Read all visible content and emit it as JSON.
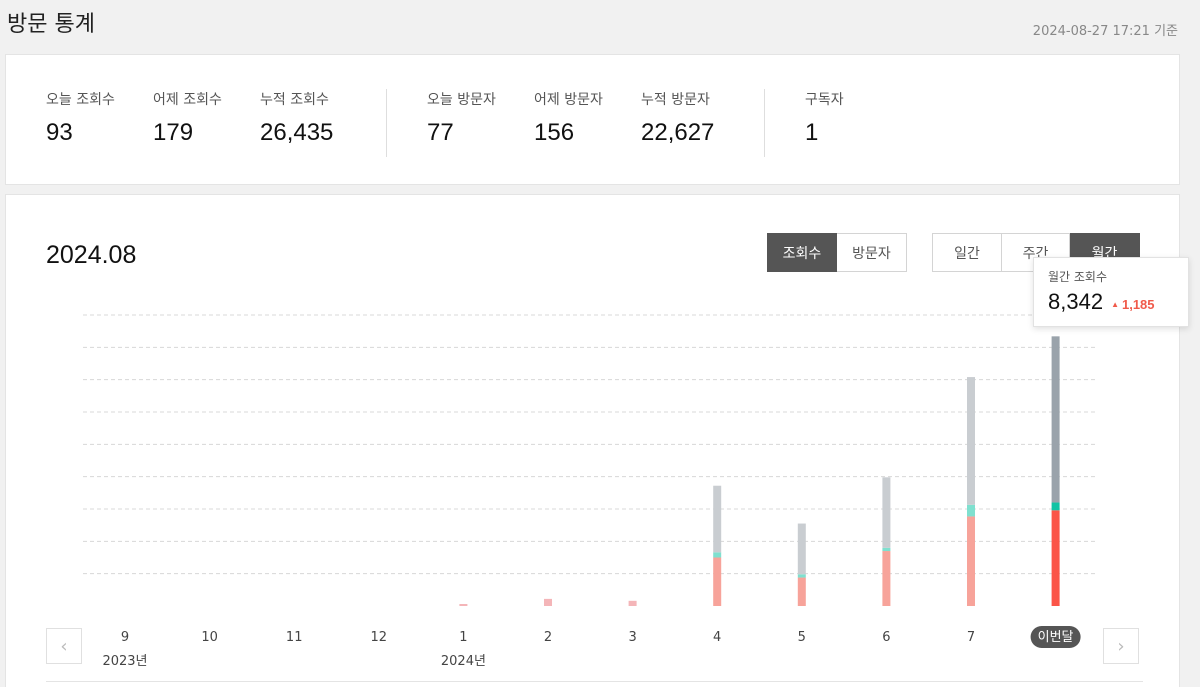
{
  "header": {
    "title": "방문 통계",
    "base_time": "2024-08-27 17:21 기준"
  },
  "stats": {
    "today_views": {
      "label": "오늘 조회수",
      "value": "93"
    },
    "yesterday_views": {
      "label": "어제 조회수",
      "value": "179"
    },
    "total_views": {
      "label": "누적 조회수",
      "value": "26,435"
    },
    "today_visitors": {
      "label": "오늘 방문자",
      "value": "77"
    },
    "yesterday_visitors": {
      "label": "어제 방문자",
      "value": "156"
    },
    "total_visitors": {
      "label": "누적 방문자",
      "value": "22,627"
    },
    "subscribers": {
      "label": "구독자",
      "value": "1"
    }
  },
  "chart_header": {
    "period": "2024.08",
    "metric_tabs": [
      "조회수",
      "방문자"
    ],
    "metric_active": 0,
    "range_tabs": [
      "일간",
      "주간",
      "월간"
    ],
    "range_active": 2
  },
  "tooltip": {
    "label": "월간 조회수",
    "value": "8,342",
    "change": "1,185"
  },
  "colors": {
    "gray": "#c9cdd1",
    "gray_active": "#9aa3ab",
    "teal": "#7fe0cf",
    "teal_active": "#12c3a4",
    "red": "#f7a39a",
    "red_active": "#fb5548",
    "tiny": "#f4b5b8"
  },
  "prev_arrow": "‹",
  "next_arrow": "›",
  "chart_data": {
    "type": "bar",
    "stacked": true,
    "categories": [
      "9",
      "10",
      "11",
      "12",
      "1",
      "2",
      "3",
      "4",
      "5",
      "6",
      "7",
      "이번달"
    ],
    "year_labels": [
      {
        "category": "9",
        "label": "2023년"
      },
      {
        "category": "1",
        "label": "2024년"
      }
    ],
    "active_index": 11,
    "series": [
      {
        "values": [
          0,
          0,
          0,
          0,
          30,
          160,
          100,
          2060,
          1570,
          2180,
          3950,
          5140
        ]
      },
      {
        "values": [
          0,
          0,
          0,
          0,
          0,
          60,
          60,
          160,
          100,
          100,
          360,
          240
        ]
      },
      {
        "values": [
          0,
          0,
          0,
          0,
          0,
          0,
          0,
          1500,
          880,
          1700,
          2770,
          2960
        ]
      }
    ],
    "ylim": [
      0,
      9000
    ],
    "grid": true,
    "gridlines": 9
  }
}
